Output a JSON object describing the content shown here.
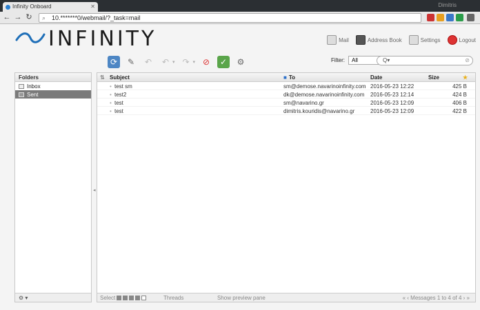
{
  "browser": {
    "tab_title": "Infinity Onboard",
    "url": "10.*******0/webmail/?_task=mail",
    "window_user": "Dimitris"
  },
  "app": {
    "logo_text": "INFINITY"
  },
  "topnav": {
    "mail": "Mail",
    "address_book": "Address Book",
    "settings": "Settings",
    "logout": "Logout"
  },
  "filter": {
    "label": "Filter:",
    "selected": "All"
  },
  "search": {
    "placeholder": "Q▾"
  },
  "folders": {
    "header": "Folders",
    "items": [
      {
        "label": "Inbox",
        "selected": false
      },
      {
        "label": "Sent",
        "selected": true
      }
    ],
    "footer": "⚙ ▾"
  },
  "messages": {
    "columns": {
      "subject": "Subject",
      "to": "To",
      "date": "Date",
      "size": "Size"
    },
    "rows": [
      {
        "subject": "test sm",
        "to": "sm@demose.navarinoinfinity.com",
        "date": "2016-05-23 12:22",
        "size": "425 B"
      },
      {
        "subject": "test2",
        "to": "dk@demose.navarinoinfinity.com",
        "date": "2016-05-23 12:14",
        "size": "424 B"
      },
      {
        "subject": "test",
        "to": "sm@navarino.gr",
        "date": "2016-05-23 12:09",
        "size": "406 B"
      },
      {
        "subject": "test",
        "to": "dimitris.kouridis@navarino.gr",
        "date": "2016-05-23 12:09",
        "size": "422 B"
      }
    ]
  },
  "footer": {
    "select": "Select",
    "threads": "Threads",
    "preview": "Show preview pane",
    "count": "Messages 1 to 4 of 4"
  },
  "colors": {
    "accent": "#4d86c4",
    "selected_folder": "#7a7a7a"
  }
}
